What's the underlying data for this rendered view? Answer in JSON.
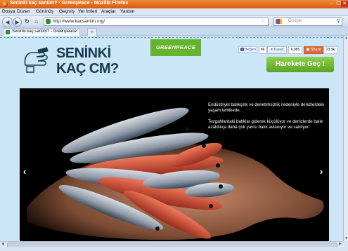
{
  "window": {
    "title": "Seninki kaç santim? · Greenpeace - Mozilla Firefox",
    "controls": [
      "–",
      "❐",
      "✕"
    ]
  },
  "menu": [
    "Dosya",
    "Düzen",
    "Görünüş",
    "Geçmiş",
    "Yer İmleri",
    "Araçlar",
    "Yardım"
  ],
  "nav": {
    "url": "http://www.kacsantim.org/",
    "search_placeholder": "Google"
  },
  "tab": {
    "label": "Seninki kaç santim? - Greenpeace",
    "new_tab": "+"
  },
  "page": {
    "headline_line1": "SENİNKİ",
    "headline_line2": "KAÇ CM?",
    "org_logo": "GREENPEACE",
    "social": {
      "like_label": "Beğen",
      "like_count": "66",
      "tweet_label": "Tweet",
      "tweet_count": "6,985",
      "share_label": "Share",
      "share_count": "23.9k"
    },
    "cta_label": "Harekete Geç !",
    "caption_paragraph_1": "Endüstriyel balıkçılık ve denetimsizlik nedeniyle denizlerdeki yaşam tehlikede.",
    "caption_paragraph_2": "Tezgahlardaki balıklar giderek küçülüyor ve denizlerde balık azaldıkça daha çok yavru balık avlanıyor ve satılıyor.",
    "prev_arrow": "‹",
    "next_arrow": "›"
  },
  "colors": {
    "page_bg": "#cbe6f6",
    "headline": "#173a52",
    "greenpeace": "#66b32e",
    "cta": "#6bb62f"
  }
}
